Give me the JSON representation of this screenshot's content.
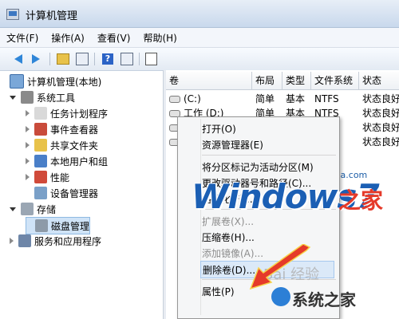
{
  "window": {
    "title": "计算机管理"
  },
  "menubar": [
    {
      "name": "menu-file",
      "label": "文件(F)"
    },
    {
      "name": "menu-action",
      "label": "操作(A)"
    },
    {
      "name": "menu-view",
      "label": "查看(V)"
    },
    {
      "name": "menu-help",
      "label": "帮助(H)"
    }
  ],
  "toolbar": {
    "icons": [
      "back-arrow-icon",
      "forward-arrow-icon",
      "up-folder-icon",
      "console-tree-icon",
      "help-icon",
      "show-hide-icon",
      "properties-icon"
    ]
  },
  "tree": {
    "root": "计算机管理(本地)",
    "items": [
      {
        "label": "系统工具",
        "level": 1,
        "expand": "open",
        "icon": "tools-icon"
      },
      {
        "label": "任务计划程序",
        "level": 2,
        "expand": "closed",
        "icon": "clock-icon"
      },
      {
        "label": "事件查看器",
        "level": 2,
        "expand": "closed",
        "icon": "event-viewer-icon"
      },
      {
        "label": "共享文件夹",
        "level": 2,
        "expand": "closed",
        "icon": "shared-folder-icon"
      },
      {
        "label": "本地用户和组",
        "level": 2,
        "expand": "closed",
        "icon": "users-icon"
      },
      {
        "label": "性能",
        "level": 2,
        "expand": "closed",
        "icon": "performance-icon"
      },
      {
        "label": "设备管理器",
        "level": 2,
        "expand": "none",
        "icon": "device-manager-icon"
      },
      {
        "label": "存储",
        "level": 1,
        "expand": "open",
        "icon": "storage-icon"
      },
      {
        "label": "磁盘管理",
        "level": 2,
        "expand": "none",
        "icon": "disk-icon",
        "selected": true
      },
      {
        "label": "服务和应用程序",
        "level": 1,
        "expand": "closed",
        "icon": "services-icon"
      }
    ]
  },
  "table": {
    "headers": [
      "卷",
      "布局",
      "类型",
      "文件系统",
      "状态"
    ],
    "rows": [
      {
        "vol": "(C:)",
        "layout": "简单",
        "type": "基本",
        "fs": "NTFS",
        "status": "状态良好"
      },
      {
        "vol": "工作 (D:)",
        "layout": "简单",
        "type": "基本",
        "fs": "NTFS",
        "status": "状态良好"
      },
      {
        "vol": "",
        "layout": "",
        "type": "",
        "fs": "",
        "status": "状态良好"
      },
      {
        "vol": "",
        "layout": "",
        "type": "",
        "fs": "",
        "status": "状态良好"
      }
    ]
  },
  "context_menu": {
    "items": [
      {
        "label": "打开(O)",
        "disabled": false
      },
      {
        "label": "资源管理器(E)",
        "disabled": false
      },
      {
        "sep": true
      },
      {
        "label": "将分区标记为活动分区(M)",
        "disabled": false
      },
      {
        "label": "更改驱动器号和路径(C)...",
        "disabled": false
      },
      {
        "label": "格式化(F)...",
        "disabled": false
      },
      {
        "sep": true
      },
      {
        "label": "扩展卷(X)...",
        "disabled": true
      },
      {
        "label": "压缩卷(H)...",
        "disabled": false
      },
      {
        "label": "添加镜像(A)...",
        "disabled": true
      },
      {
        "label": "删除卷(D)...",
        "disabled": false,
        "highlight": true
      },
      {
        "sep": true
      },
      {
        "label": "属性(P)",
        "disabled": false
      }
    ]
  },
  "watermarks": {
    "url": "www.win7china.com",
    "logo": "Windows7",
    "logo_suffix": "之家",
    "site": "系统之家",
    "baidu": "Bai 经验"
  },
  "colors": {
    "accent": "#1b5fb4",
    "arrow": "#e53a2a",
    "selection": "#cfe3f7"
  }
}
